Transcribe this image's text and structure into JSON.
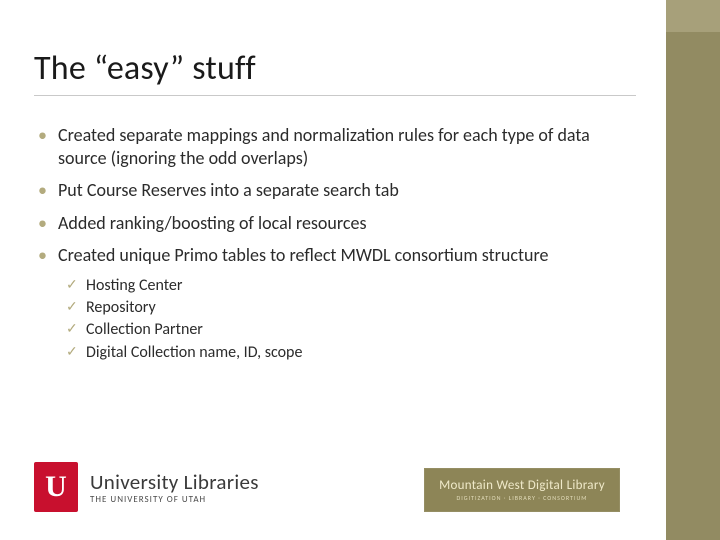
{
  "title": "The “easy” stuff",
  "bullets": [
    {
      "text": "Created separate mappings and normalization rules for each type of data source (ignoring the odd overlaps)"
    },
    {
      "text": "Put Course Reserves into a separate search tab"
    },
    {
      "text": "Added ranking/boosting of local resources"
    },
    {
      "text": "Created unique Primo tables to reflect MWDL consortium structure",
      "children": [
        {
          "text": "Hosting Center"
        },
        {
          "text": "Repository"
        },
        {
          "text": "Collection Partner"
        },
        {
          "text": "Digital Collection name, ID, scope"
        }
      ]
    }
  ],
  "logo_left": {
    "block_letter": "U",
    "line1": "University Libraries",
    "line2": "THE UNIVERSITY OF UTAH"
  },
  "logo_right": {
    "line1": "Mountain West Digital Library",
    "line2": "DIGITIZATION · LIBRARY · CONSORTIUM"
  }
}
